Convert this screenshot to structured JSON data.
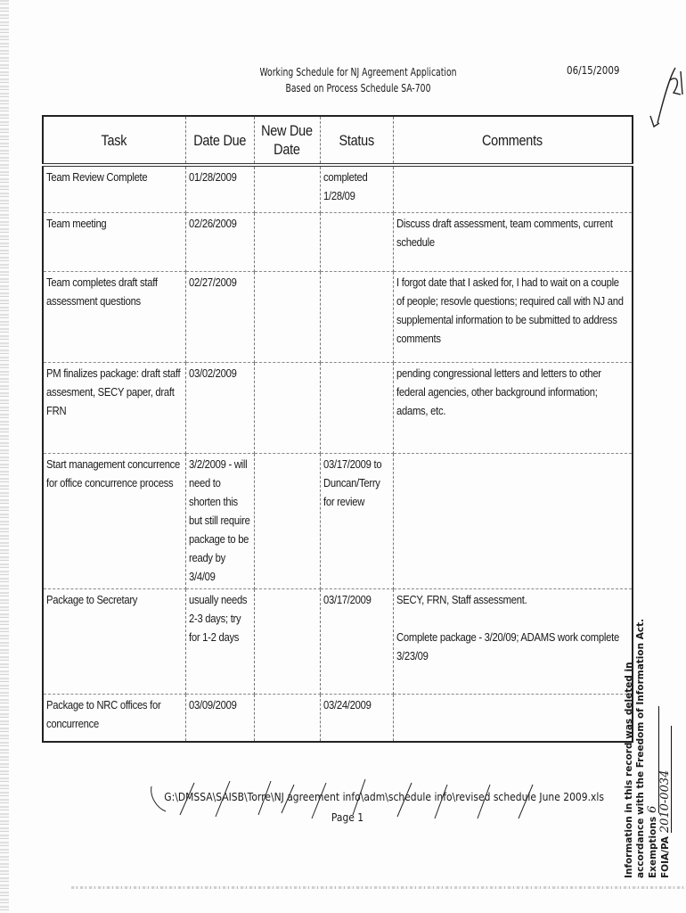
{
  "document": {
    "title_line1": "Working Schedule for NJ Agreement Application",
    "title_line2": "Based on Process Schedule SA-700",
    "date": "06/15/2009",
    "handwritten_page_mark": "1/21",
    "footer_path": "G:\\DMSSA\\SAISB\\Torre\\NJ agreement info\\adm\\schedule info\\revised schedule June 2009.xls",
    "footer_page": "Page 1"
  },
  "table": {
    "columns": [
      "Task",
      "Date Due",
      "New Due Date",
      "Status",
      "Comments"
    ],
    "column_header_newdue_line1": "New Due",
    "column_header_newdue_line2": "Date",
    "rows": [
      {
        "task": "Team Review Complete",
        "date_due": "01/28/2009",
        "new_due_date": "",
        "status": "completed 1/28/09",
        "comments": ""
      },
      {
        "task": "Team meeting",
        "date_due": "02/26/2009",
        "new_due_date": "",
        "status": "",
        "comments": "Discuss draft assessment, team comments, current schedule"
      },
      {
        "task": "Team completes draft staff assessment questions",
        "date_due": "02/27/2009",
        "new_due_date": "",
        "status": "",
        "comments": "I forgot date that I asked for, I had to wait on a couple of people; resovle questions; required call with NJ and supplemental information to be submitted to address comments"
      },
      {
        "task": "PM finalizes package: draft staff assesment, SECY paper, draft FRN",
        "date_due": "03/02/2009",
        "new_due_date": "",
        "status": "",
        "comments": "pending congressional letters and letters to other federal agencies, other background information; adams, etc."
      },
      {
        "task": "Start management concurrence for office concurrence process",
        "date_due": "3/2/2009 - will need to shorten this but still require package to be ready by 3/4/09",
        "new_due_date": "",
        "status": "03/17/2009 to Duncan/Terry for review",
        "comments": ""
      },
      {
        "task": "Package to Secretary",
        "date_due": "usually needs 2-3 days; try for 1-2 days",
        "new_due_date": "",
        "status": "03/17/2009",
        "comments": "SECY, FRN, Staff assessment.",
        "comments_line2": "Complete package - 3/20/09; ADAMS work complete 3/23/09"
      },
      {
        "task": "Package to NRC offices for concurrence",
        "date_due": "03/09/2009",
        "new_due_date": "",
        "status": "03/24/2009",
        "comments": ""
      }
    ]
  },
  "foia_stamp": {
    "line1": "Information in this record was deleted in",
    "line2": "accordance with the Freedom of Information Act.",
    "line3_label": "Exemptions",
    "line3_value": "6",
    "line4_label": "FOIA/PA",
    "line4_value": "2010-0034"
  }
}
